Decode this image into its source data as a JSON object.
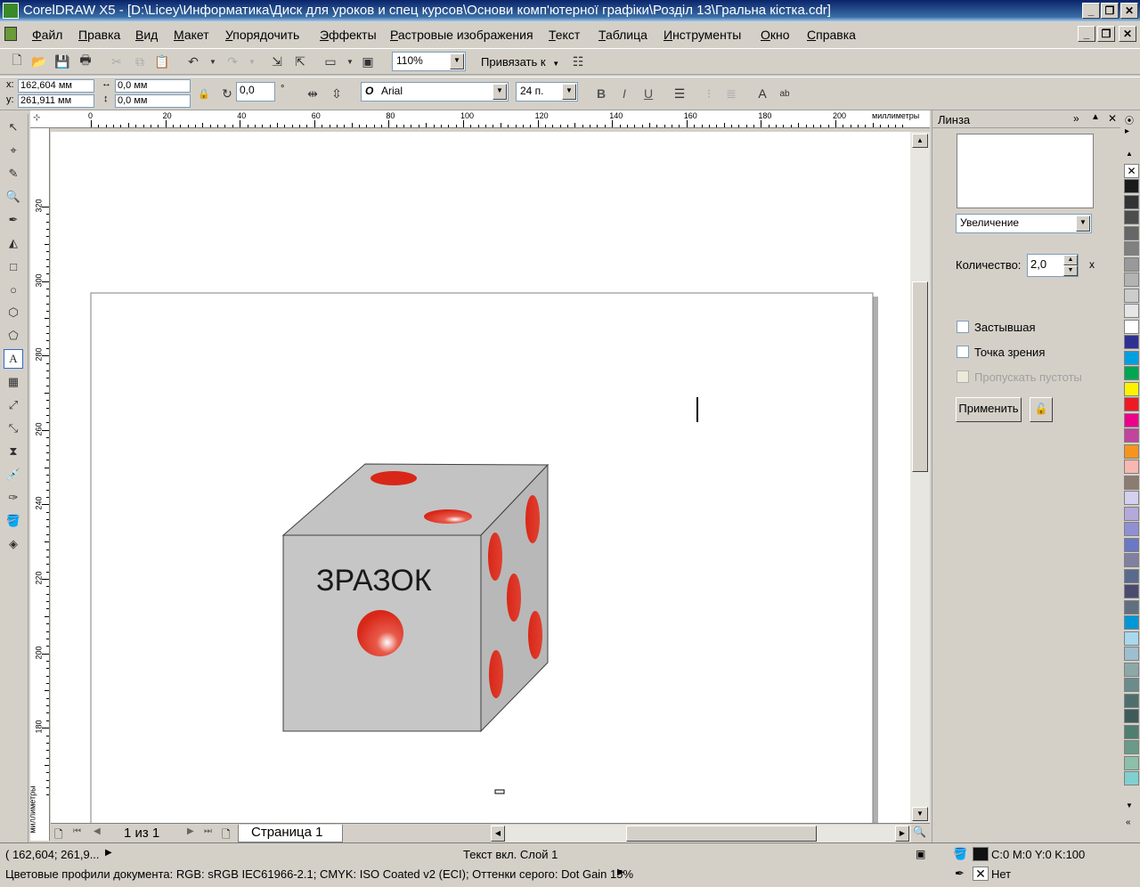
{
  "titlebar": {
    "title": "CorelDRAW X5 - [D:\\Licey\\Информатика\\Диск для уроков и спец курсов\\Основи комп'ютерної графіки\\Розділ 13\\Гральна кістка.cdr]"
  },
  "menu": [
    "Файл",
    "Правка",
    "Вид",
    "Макет",
    "Упорядочить",
    "Эффекты",
    "Растровые изображения",
    "Текст",
    "Таблица",
    "Инструменты",
    "Окно",
    "Справка"
  ],
  "standard_toolbar": {
    "zoom": "110%",
    "snap_label": "Привязать к"
  },
  "property_bar": {
    "x": "162,604 мм",
    "y": "261,911 мм",
    "x_label": "x:",
    "y_label": "y:",
    "width": "0,0 мм",
    "height": "0,0 мм",
    "angle": "0,0",
    "angle_unit": "°",
    "font_name": "Arial",
    "font_size": "24 п.",
    "bold": "B",
    "italic": "I",
    "underline": "U"
  },
  "rulers": {
    "h_ticks": [
      "0",
      "20",
      "40",
      "60",
      "80",
      "100",
      "120",
      "140",
      "160",
      "180",
      "200"
    ],
    "h_unit": "миллиметры",
    "v_ticks": [
      "320",
      "300",
      "280",
      "260",
      "240",
      "220",
      "200",
      "180"
    ],
    "v_unit": "миллиметры"
  },
  "canvas": {
    "dice_text": "ЗРАЗОК"
  },
  "page_nav": {
    "counter": "1 из 1",
    "tab": "Страница 1"
  },
  "docker": {
    "title": "Линза",
    "lens_type": "Увеличение",
    "amount_label": "Количество:",
    "amount_value": "2,0",
    "amount_unit": "x",
    "frozen": "Застывшая",
    "viewpoint": "Точка зрения",
    "remove_face": "Пропускать пустоты",
    "apply": "Применить"
  },
  "palette": [
    "#1a1a1a",
    "#333333",
    "#4d4d4d",
    "#666666",
    "#808080",
    "#999999",
    "#b3b3b3",
    "#cccccc",
    "#e6e6e6",
    "#ffffff",
    "#2e3192",
    "#00a0e0",
    "#00a651",
    "#fff200",
    "#ed1c24",
    "#ec008c",
    "#c2449c",
    "#f7941d",
    "#f9b7b1",
    "#8c7b70",
    "#d4d0ef",
    "#b5a9dc",
    "#8f8fd4",
    "#6b78c4",
    "#8080a0",
    "#5a6a8c",
    "#4b4b70",
    "#607080",
    "#0097d6",
    "#a8d8ee",
    "#9ebfd0",
    "#8da8a8",
    "#6b8c8c",
    "#4e6e6e",
    "#3e5a5a",
    "#4e7e70",
    "#6a9a88",
    "#8cc0a8",
    "#80d0d0"
  ],
  "status": {
    "coords": "( 162,604; 261,9...",
    "object_info": "Текст вкл. Слой 1",
    "color_profiles": "Цветовые профили документа: RGB: sRGB IEC61966-2.1; CMYK: ISO Coated v2 (ECI); Оттенки серого: Dot Gain 15%",
    "fill": "C:0 M:0 Y:0 K:100",
    "outline": "Нет"
  }
}
